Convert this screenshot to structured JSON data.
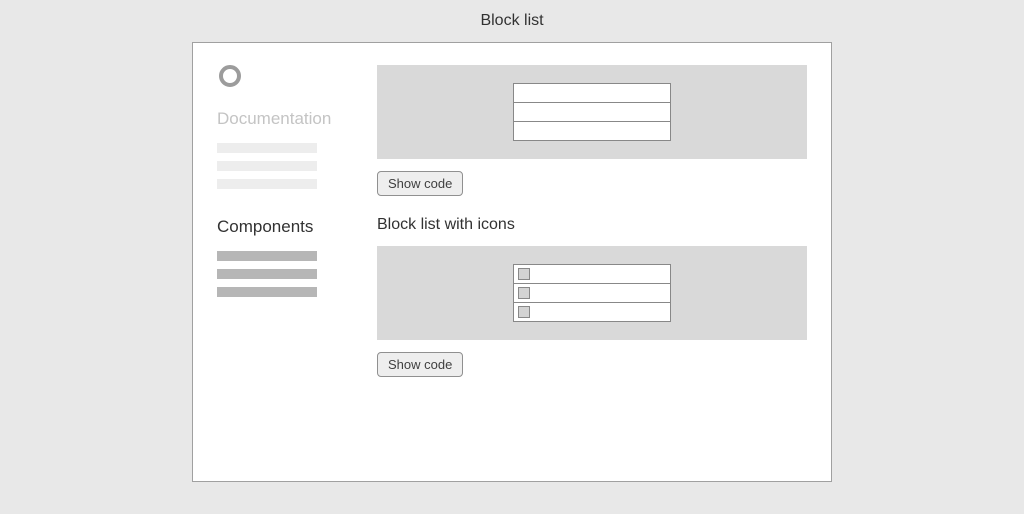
{
  "pageTitle": "Block list",
  "sidebar": {
    "sections": [
      {
        "label": "Documentation",
        "active": false
      },
      {
        "label": "Components",
        "active": true
      }
    ]
  },
  "main": {
    "examples": [
      {
        "heading": "",
        "showCodeLabel": "Show code",
        "hasIcons": false,
        "rows": 3
      },
      {
        "heading": "Block list with icons",
        "showCodeLabel": "Show code",
        "hasIcons": true,
        "rows": 3
      }
    ]
  }
}
